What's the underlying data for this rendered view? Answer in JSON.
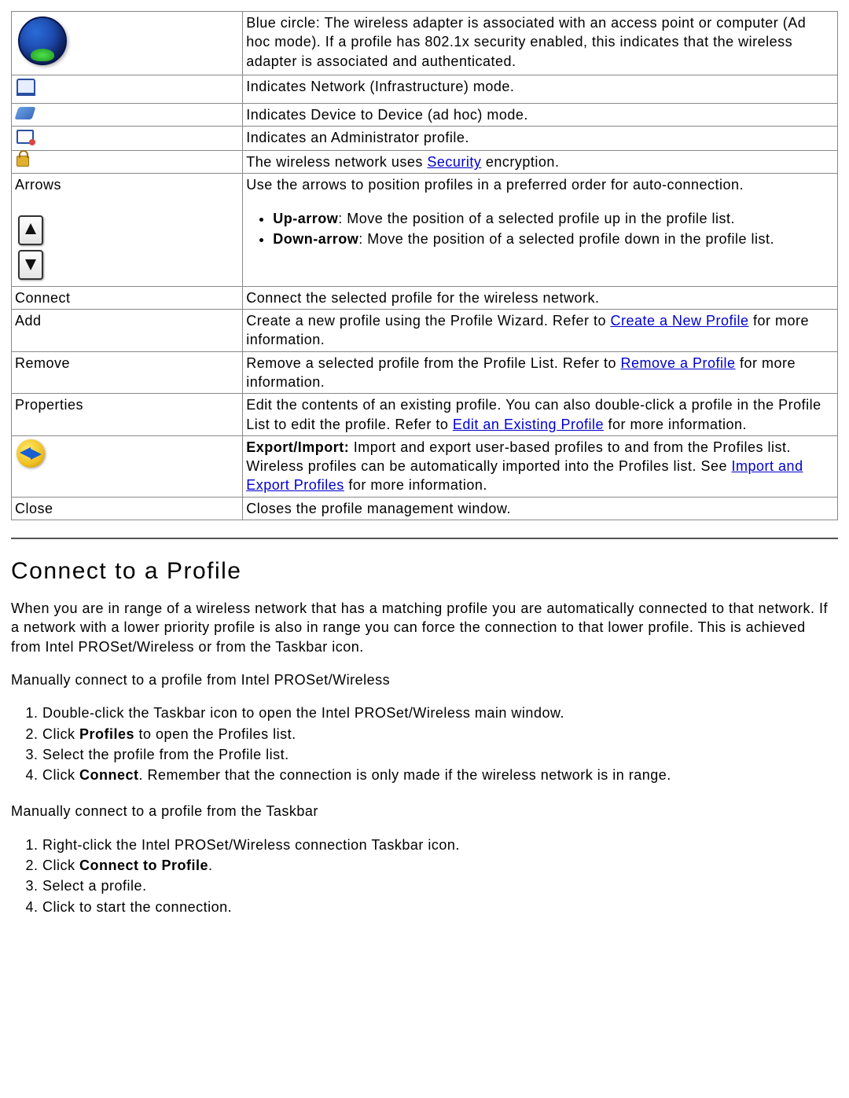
{
  "table": {
    "rows": [
      {
        "left_kind": "icon",
        "icon": "globe",
        "desc": [
          {
            "t": "text",
            "v": "Blue circle: The wireless adapter is associated with an access point or computer (Ad hoc mode). If a profile has 802.1x security enabled, this indicates that the wireless adapter is associated and authenticated."
          }
        ]
      },
      {
        "left_kind": "icon",
        "icon": "infra",
        "desc": [
          {
            "t": "text",
            "v": "Indicates Network (Infrastructure) mode."
          }
        ]
      },
      {
        "left_kind": "icon",
        "icon": "adhoc",
        "desc": [
          {
            "t": "text",
            "v": "Indicates Device to Device (ad hoc) mode."
          }
        ]
      },
      {
        "left_kind": "icon",
        "icon": "admin",
        "desc": [
          {
            "t": "text",
            "v": "Indicates an Administrator profile."
          }
        ]
      },
      {
        "left_kind": "icon",
        "icon": "lock",
        "desc": [
          {
            "t": "text",
            "v": "The wireless network uses "
          },
          {
            "t": "link",
            "v": "Security"
          },
          {
            "t": "text",
            "v": " encryption."
          }
        ]
      },
      {
        "left_kind": "arrows",
        "label": "Arrows",
        "desc_intro": "Use the arrows to position profiles in a preferred order for auto-connection.",
        "bullets": [
          {
            "bold": "Up-arrow",
            "rest": ": Move the position of a selected profile up in the profile list."
          },
          {
            "bold": "Down-arrow",
            "rest": ": Move the position of a selected profile down in the profile list."
          }
        ]
      },
      {
        "left_kind": "text",
        "label": "Connect",
        "desc": [
          {
            "t": "text",
            "v": "Connect the selected profile for the wireless network."
          }
        ]
      },
      {
        "left_kind": "text",
        "label": "Add",
        "desc": [
          {
            "t": "text",
            "v": "Create a new profile using the Profile Wizard. Refer to "
          },
          {
            "t": "link",
            "v": "Create a New Profile"
          },
          {
            "t": "text",
            "v": " for more information."
          }
        ]
      },
      {
        "left_kind": "text",
        "label": "Remove",
        "desc": [
          {
            "t": "text",
            "v": "Remove a selected profile from the Profile List. Refer to "
          },
          {
            "t": "link",
            "v": "Remove a Profile"
          },
          {
            "t": "text",
            "v": " for more information."
          }
        ]
      },
      {
        "left_kind": "text",
        "label": "Properties",
        "desc": [
          {
            "t": "text",
            "v": "Edit the contents of an existing profile. You can also double-click a profile in the Profile List to edit the profile. Refer to "
          },
          {
            "t": "link",
            "v": "Edit an Existing Profile"
          },
          {
            "t": "text",
            "v": " for more information."
          }
        ]
      },
      {
        "left_kind": "icon",
        "icon": "export",
        "desc": [
          {
            "t": "bold",
            "v": "Export/Import: "
          },
          {
            "t": "text",
            "v": "Import and export user-based profiles to and from the Profiles list.  Wireless profiles can be automatically imported into the Profiles list. See "
          },
          {
            "t": "link",
            "v": "Import and Export Profiles"
          },
          {
            "t": "text",
            "v": " for more information."
          }
        ]
      },
      {
        "left_kind": "text",
        "label": "Close",
        "desc": [
          {
            "t": "text",
            "v": "Closes the profile management window."
          }
        ]
      }
    ]
  },
  "section": {
    "heading": "Connect to a Profile",
    "intro": "When you are in range of a wireless network that has a matching profile you are automatically connected to that network. If a network with a lower priority profile is also in range you can force the connection to that lower profile. This is achieved from Intel PROSet/Wireless or from the Taskbar icon.",
    "sub1": "Manually connect to a profile from Intel PROSet/Wireless",
    "steps1": [
      [
        {
          "t": "text",
          "v": "Double-click the Taskbar icon to open the Intel PROSet/Wireless main window."
        }
      ],
      [
        {
          "t": "text",
          "v": "Click "
        },
        {
          "t": "bold",
          "v": "Profiles"
        },
        {
          "t": "text",
          "v": " to open the Profiles list."
        }
      ],
      [
        {
          "t": "text",
          "v": "Select the profile from the Profile list."
        }
      ],
      [
        {
          "t": "text",
          "v": "Click "
        },
        {
          "t": "bold",
          "v": "Connect"
        },
        {
          "t": "text",
          "v": ". Remember that the connection is only made if the wireless network is in range."
        }
      ]
    ],
    "sub2": "Manually connect to a profile from the Taskbar",
    "steps2": [
      [
        {
          "t": "text",
          "v": "Right-click the Intel PROSet/Wireless connection Taskbar icon."
        }
      ],
      [
        {
          "t": "text",
          "v": "Click "
        },
        {
          "t": "bold",
          "v": "Connect to Profile"
        },
        {
          "t": "text",
          "v": "."
        }
      ],
      [
        {
          "t": "text",
          "v": "Select a profile."
        }
      ],
      [
        {
          "t": "text",
          "v": "Click to start the connection."
        }
      ]
    ]
  }
}
